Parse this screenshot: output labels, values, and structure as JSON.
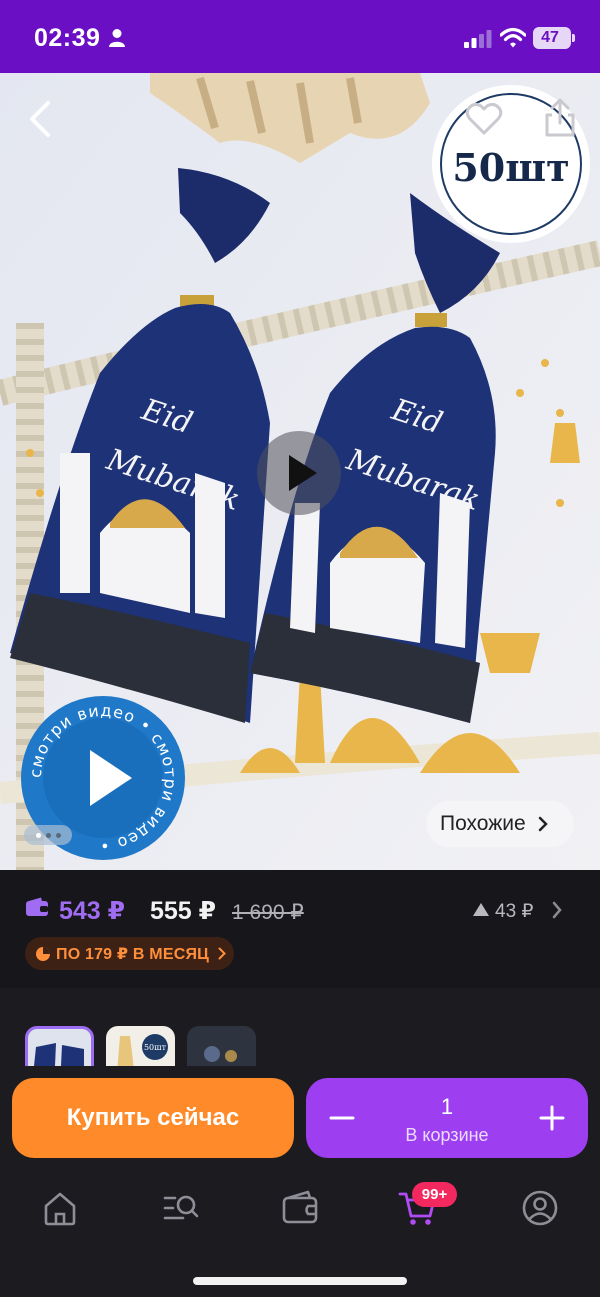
{
  "status_bar": {
    "time": "02:39",
    "battery": "47",
    "background": "#6a0fc4"
  },
  "product_image": {
    "quantity_badge": "50шт",
    "bag_text_line1": "Eid",
    "bag_text_line2": "Mubarak",
    "video_badge_text": "смотри видео • смотри видео •",
    "similar_label": "Похожие",
    "photo_count": 3,
    "current_photo": 1
  },
  "pricing": {
    "wallet_price": "543 ₽",
    "price": "555 ₽",
    "old_price": "1 690 ₽",
    "price_rise": "43 ₽",
    "installment": "ПО 179 ₽ В МЕСЯЦ",
    "wallet_color": "#a06cf2",
    "installment_color": "#ff8f3a"
  },
  "actions": {
    "buy_now_label": "Купить сейчас",
    "cart_quantity": "1",
    "cart_caption": "В корзине",
    "buy_color": "#ff8a2a",
    "cart_color": "#9d3ff0"
  },
  "variants": {
    "thumb2_badge": "50шт"
  },
  "bottom_nav": {
    "items": [
      "home-icon",
      "catalog-search-icon",
      "wallet-icon",
      "cart-icon",
      "profile-icon"
    ],
    "cart_badge": "99+",
    "badge_color": "#f2285f"
  }
}
